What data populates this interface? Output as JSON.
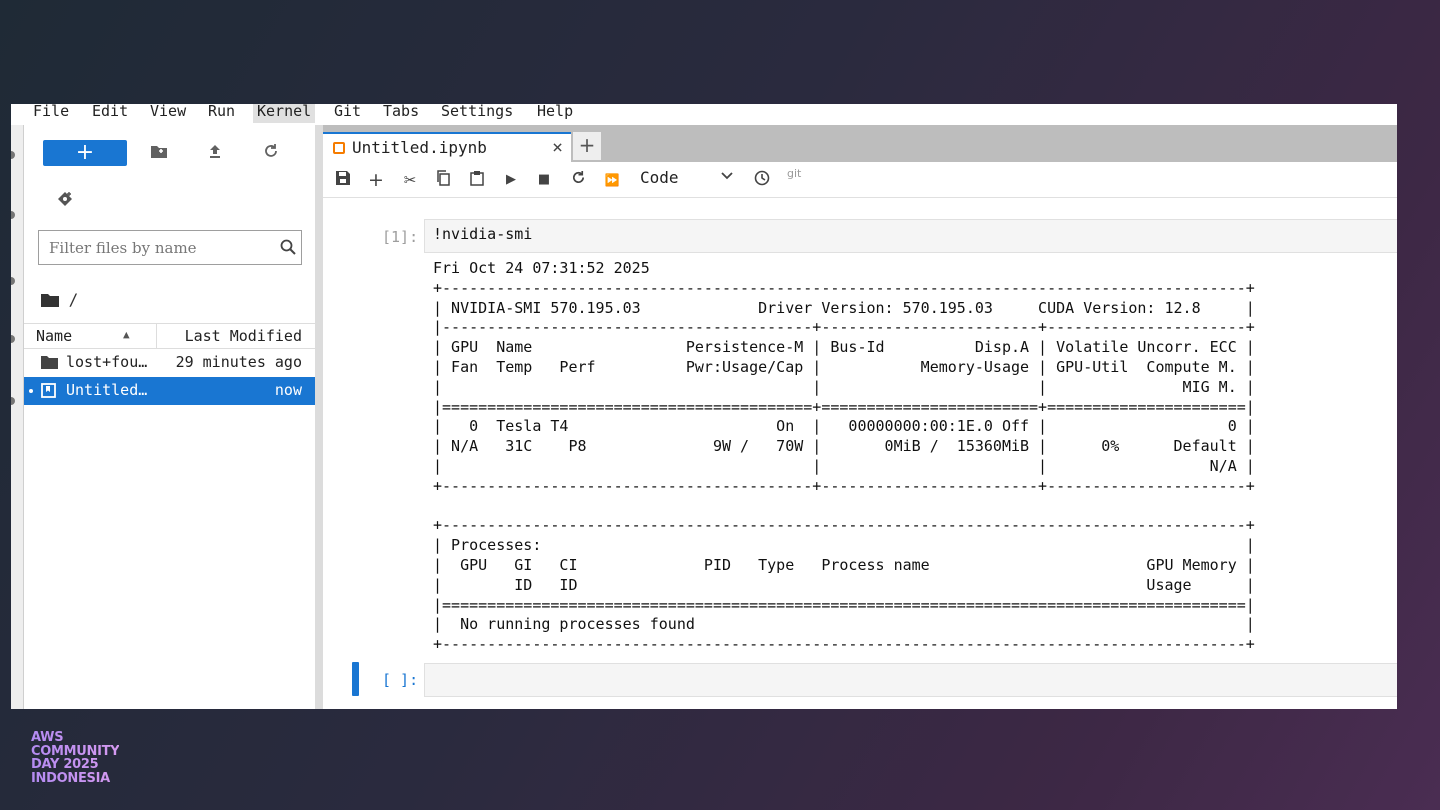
{
  "menu": [
    "File",
    "Edit",
    "View",
    "Run",
    "Kernel",
    "Git",
    "Tabs",
    "Settings",
    "Help"
  ],
  "menu_active": "Kernel",
  "filebrowser": {
    "new_label": "+",
    "filter_placeholder": "Filter files by name",
    "breadcrumb": "/",
    "columns": {
      "name": "Name",
      "modified": "Last Modified"
    },
    "files": [
      {
        "name": "lost+fou…",
        "modified": "29 minutes ago",
        "type": "folder",
        "selected": false
      },
      {
        "name": "Untitled…",
        "modified": "now",
        "type": "notebook",
        "selected": true
      }
    ]
  },
  "tabs": [
    {
      "label": "Untitled.ipynb"
    }
  ],
  "toolbar": {
    "cell_type": "Code",
    "git_label": "git"
  },
  "cells": [
    {
      "prompt": "[1]:",
      "input": "!nvidia-smi",
      "output": "Fri Oct 24 07:31:52 2025\n+-----------------------------------------------------------------------------------------+\n| NVIDIA-SMI 570.195.03             Driver Version: 570.195.03     CUDA Version: 12.8     |\n|-----------------------------------------+------------------------+----------------------+\n| GPU  Name                 Persistence-M | Bus-Id          Disp.A | Volatile Uncorr. ECC |\n| Fan  Temp   Perf          Pwr:Usage/Cap |           Memory-Usage | GPU-Util  Compute M. |\n|                                         |                        |               MIG M. |\n|=========================================+========================+======================|\n|   0  Tesla T4                       On  |   00000000:00:1E.0 Off |                    0 |\n| N/A   31C    P8              9W /   70W |       0MiB /  15360MiB |      0%      Default |\n|                                         |                        |                  N/A |\n+-----------------------------------------+------------------------+----------------------+\n\n+-----------------------------------------------------------------------------------------+\n| Processes:                                                                              |\n|  GPU   GI   CI              PID   Type   Process name                        GPU Memory |\n|        ID   ID                                                               Usage      |\n|=========================================================================================|\n|  No running processes found                                                             |\n+-----------------------------------------------------------------------------------------+"
    },
    {
      "prompt": "[ ]:",
      "input": ""
    }
  ],
  "branding": [
    "AWS",
    "COMMUNITY",
    "DAY 2025",
    "INDONESIA"
  ],
  "colors": {
    "accent": "#1976d2",
    "notebook_icon": "#f57c00"
  }
}
